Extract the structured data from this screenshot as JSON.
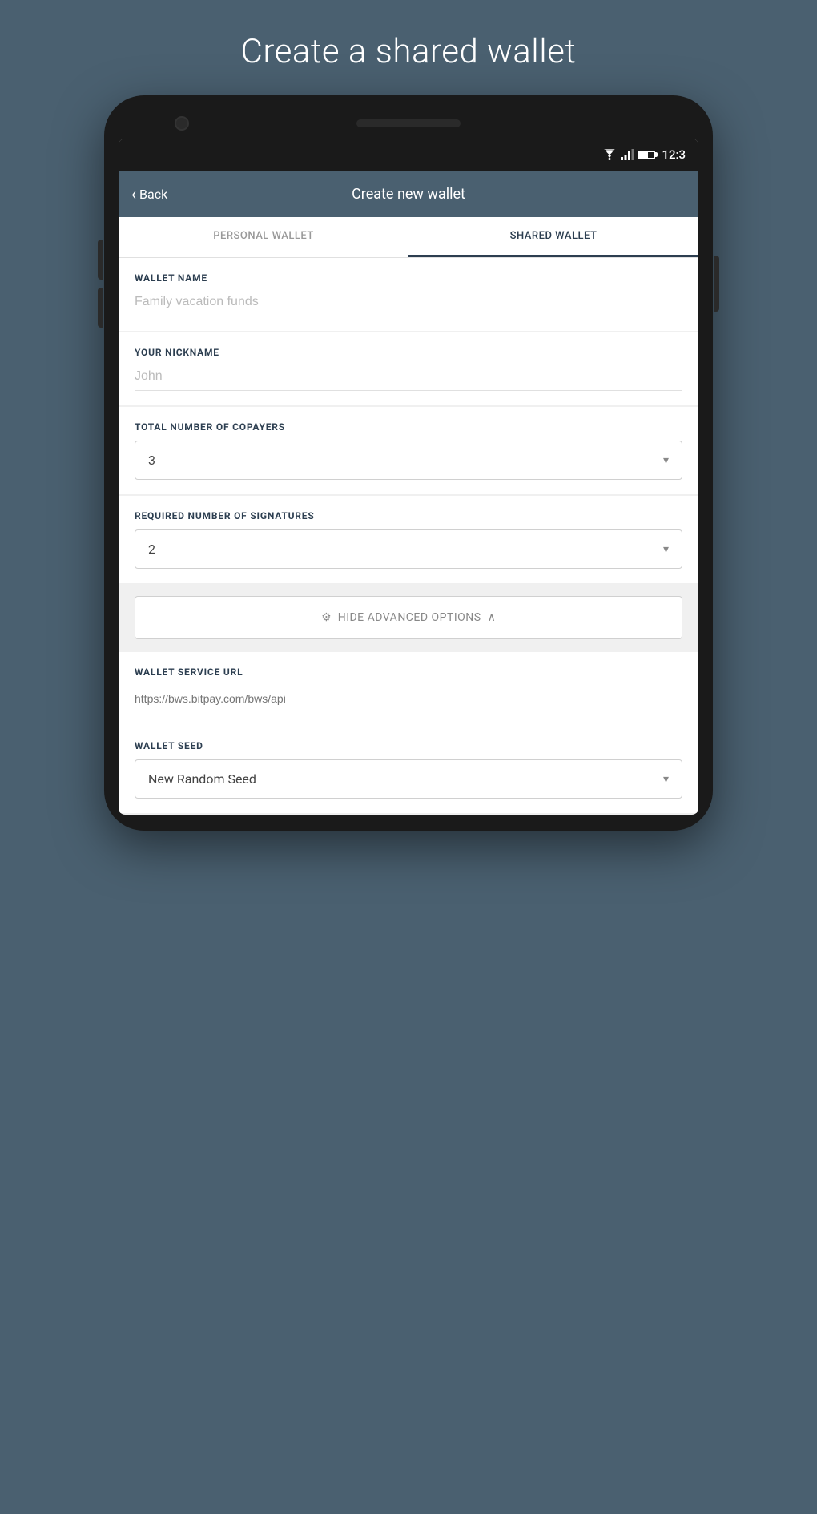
{
  "page": {
    "title": "Create a shared wallet"
  },
  "status_bar": {
    "time": "12:3"
  },
  "header": {
    "back_label": "Back",
    "title": "Create new wallet"
  },
  "tabs": [
    {
      "id": "personal",
      "label": "PERSONAL WALLET",
      "active": false
    },
    {
      "id": "shared",
      "label": "SHARED WALLET",
      "active": true
    }
  ],
  "fields": {
    "wallet_name": {
      "label": "WALLET NAME",
      "placeholder": "Family vacation funds"
    },
    "nickname": {
      "label": "YOUR NICKNAME",
      "placeholder": "John"
    },
    "copayers": {
      "label": "TOTAL NUMBER OF COPAYERS",
      "value": "3"
    },
    "signatures": {
      "label": "REQUIRED NUMBER OF SIGNATURES",
      "value": "2"
    },
    "service_url": {
      "label": "WALLET SERVICE URL",
      "placeholder": "https://bws.bitpay.com/bws/api"
    },
    "wallet_seed": {
      "label": "WALLET SEED",
      "value": "New Random Seed"
    }
  },
  "advanced_options": {
    "button_label": "HIDE ADVANCED OPTIONS",
    "icon": "⚙"
  }
}
